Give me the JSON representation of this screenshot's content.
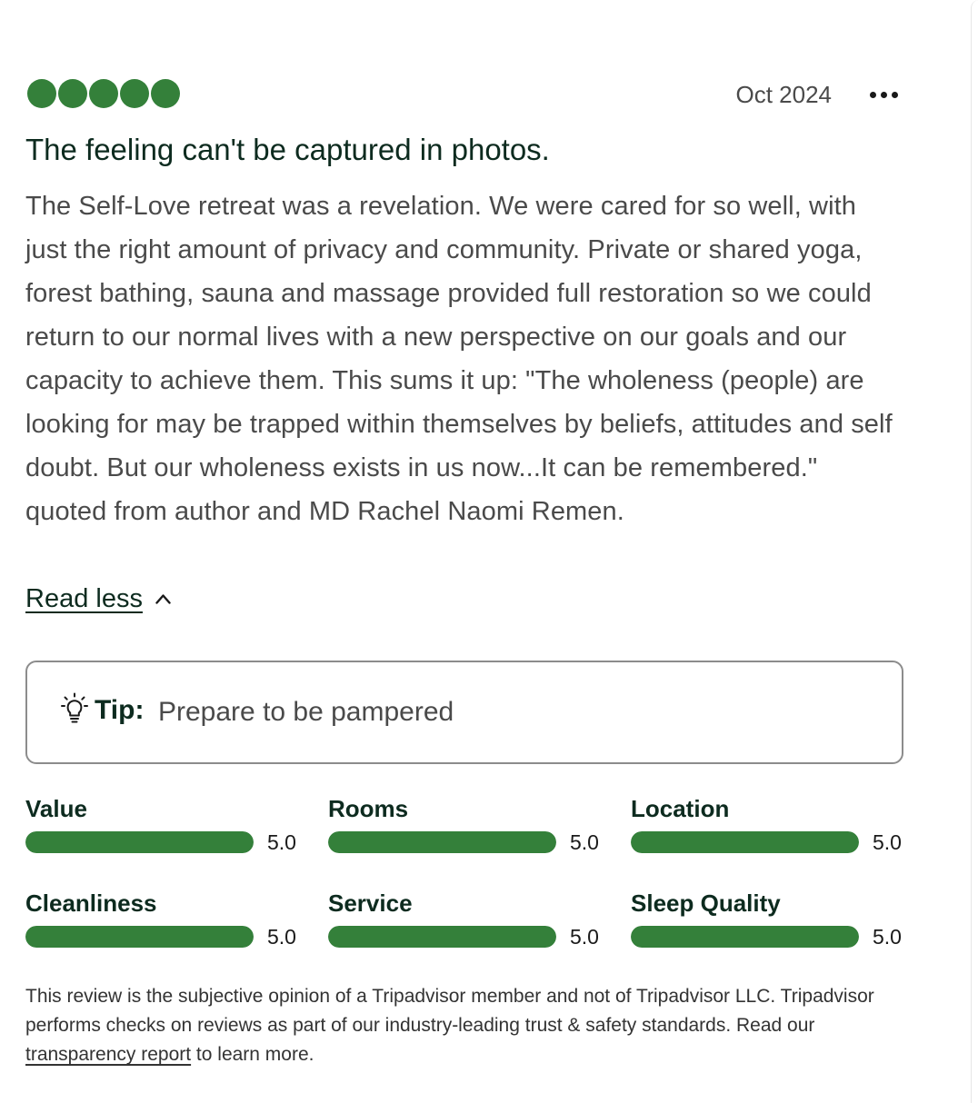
{
  "review": {
    "rating": 5,
    "rating_max": 5,
    "date": "Oct 2024",
    "title": "The feeling can't be captured in photos.",
    "body": "The Self-Love retreat was a revelation. We were cared for so well, with just the right amount of privacy and community. Private or shared yoga, forest bathing, sauna and massage provided full restoration so we could return to our normal lives with a new perspective on our goals and our capacity to achieve them. This sums it up: \"The wholeness (people) are looking for may be trapped within themselves by beliefs, attitudes and self doubt. But our wholeness exists in us now...It can be remembered.\" quoted from author and MD Rachel Naomi Remen.",
    "read_less_label": "Read less",
    "more_icon": "more-dots-icon",
    "chevron_icon": "chevron-up-icon"
  },
  "tip": {
    "icon": "lightbulb-icon",
    "label": "Tip:",
    "text": "Prepare to be pampered"
  },
  "subratings": [
    {
      "label": "Value",
      "value": "5.0",
      "score": 5.0,
      "max": 5.0
    },
    {
      "label": "Rooms",
      "value": "5.0",
      "score": 5.0,
      "max": 5.0
    },
    {
      "label": "Location",
      "value": "5.0",
      "score": 5.0,
      "max": 5.0
    },
    {
      "label": "Cleanliness",
      "value": "5.0",
      "score": 5.0,
      "max": 5.0
    },
    {
      "label": "Service",
      "value": "5.0",
      "score": 5.0,
      "max": 5.0
    },
    {
      "label": "Sleep Quality",
      "value": "5.0",
      "score": 5.0,
      "max": 5.0
    }
  ],
  "disclaimer": {
    "text_before": "This review is the subjective opinion of a Tripadvisor member and not of Tripadvisor LLC. Tripadvisor performs checks on reviews as part of our industry-leading trust & safety standards. Read our ",
    "link_label": "transparency report",
    "text_after": " to learn more."
  },
  "colors": {
    "accent_green": "#34803a",
    "text_dark_green": "#0d2b1f",
    "text_body": "#4a4a4a",
    "border": "#8c8c8c"
  }
}
